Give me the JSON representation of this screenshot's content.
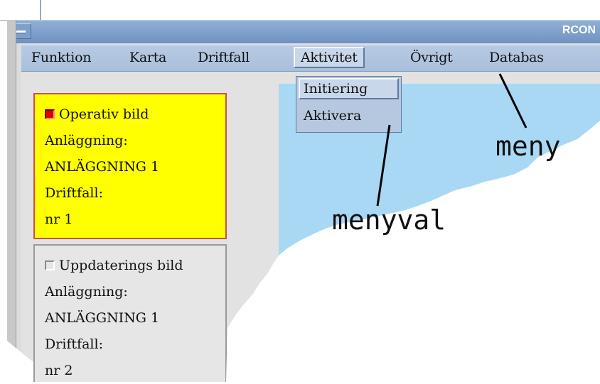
{
  "window": {
    "title": "RCON"
  },
  "menubar": {
    "items": [
      {
        "label": "Funktion"
      },
      {
        "label": "Karta"
      },
      {
        "label": "Driftfall"
      },
      {
        "label": "Aktivitet"
      },
      {
        "label": "Övrigt"
      },
      {
        "label": "Databas"
      }
    ],
    "active": "Aktivitet"
  },
  "dropdown": {
    "items": [
      {
        "label": "Initiering"
      },
      {
        "label": "Aktivera"
      }
    ]
  },
  "panels": [
    {
      "checkbox_checked": true,
      "title": "Operativ bild",
      "plant_label": "Anläggning:",
      "plant_value": "ANLÄGGNING 1",
      "case_label": "Driftfall:",
      "case_value": "nr 1"
    },
    {
      "checkbox_checked": false,
      "title": "Uppdaterings bild",
      "plant_label": "Anläggning:",
      "plant_value": "ANLÄGGNING 1",
      "case_label": "Driftfall:",
      "case_value": "nr 2"
    }
  ],
  "annotations": {
    "menu": "meny",
    "menu_choice": "menyval"
  },
  "colors": {
    "titlebar": "#7f9fca",
    "menubar": "#b0c4df",
    "panel_active": "#ffff00",
    "panel_active_border": "#c85050",
    "map": "#a9d8f5"
  }
}
